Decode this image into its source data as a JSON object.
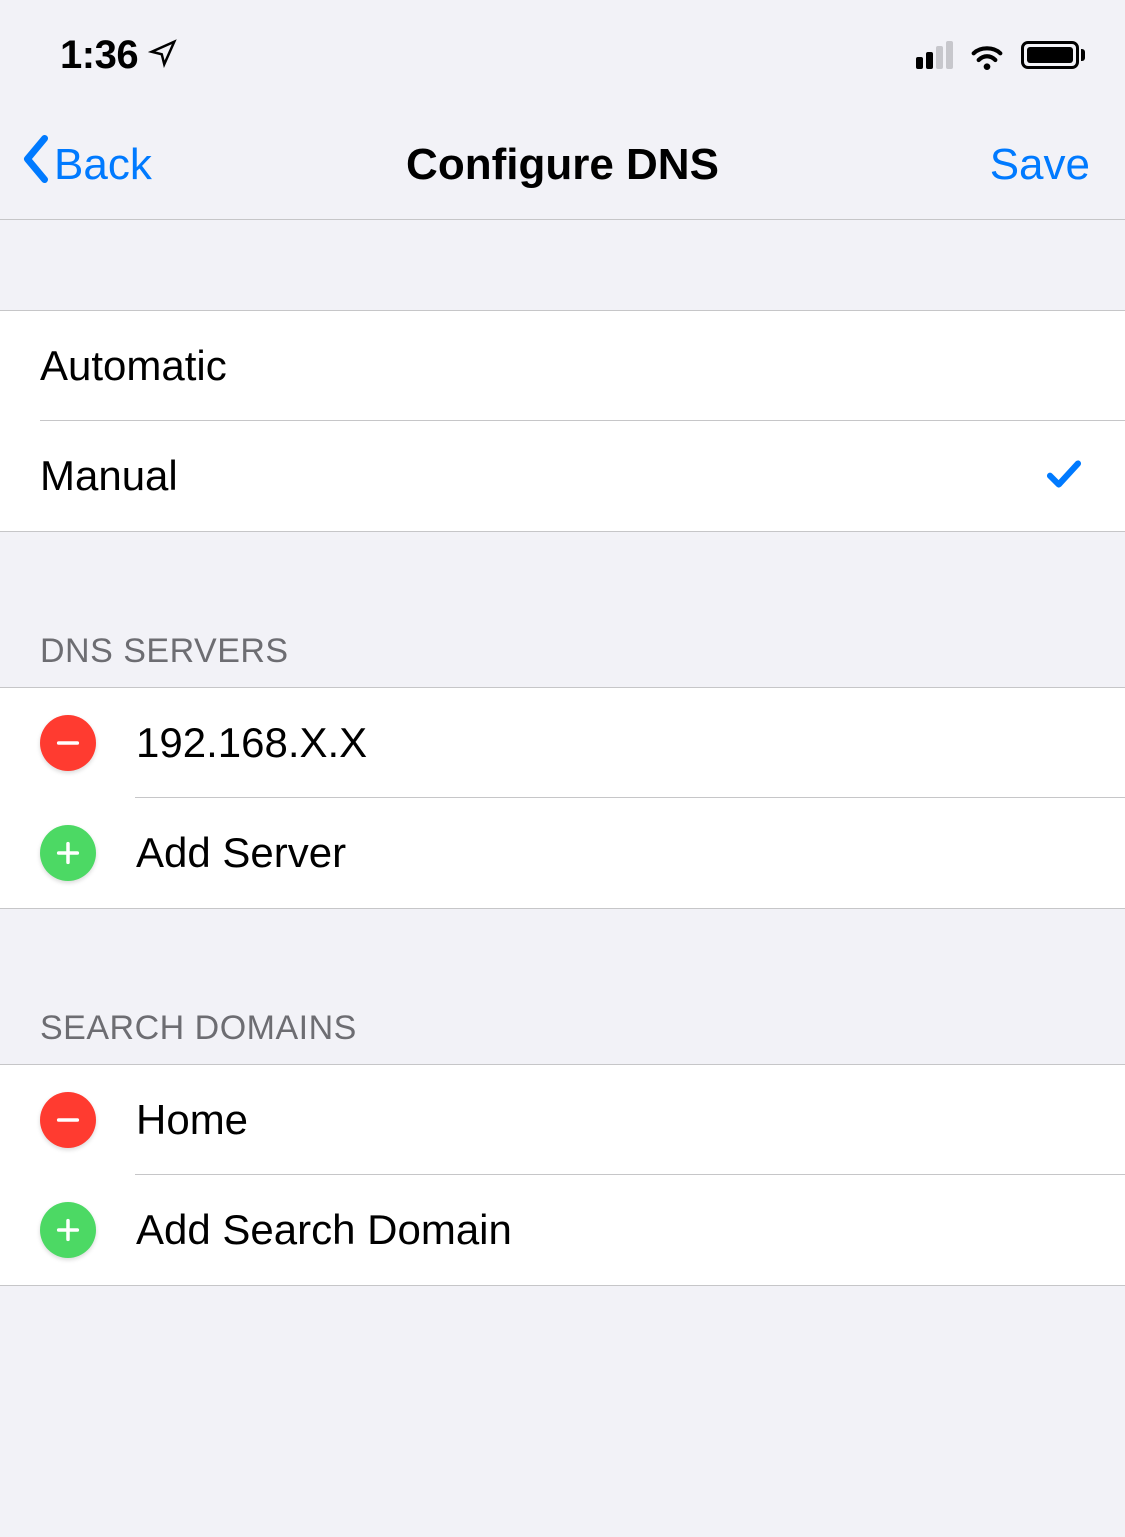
{
  "status_bar": {
    "time": "1:36"
  },
  "nav": {
    "back_label": "Back",
    "title": "Configure DNS",
    "save_label": "Save"
  },
  "mode": {
    "options": [
      {
        "label": "Automatic",
        "selected": false
      },
      {
        "label": "Manual",
        "selected": true
      }
    ]
  },
  "dns_servers": {
    "header": "DNS SERVERS",
    "entries": [
      {
        "value": "192.168.X.X"
      }
    ],
    "add_label": "Add Server"
  },
  "search_domains": {
    "header": "SEARCH DOMAINS",
    "entries": [
      {
        "value": "Home"
      }
    ],
    "add_label": "Add Search Domain"
  }
}
